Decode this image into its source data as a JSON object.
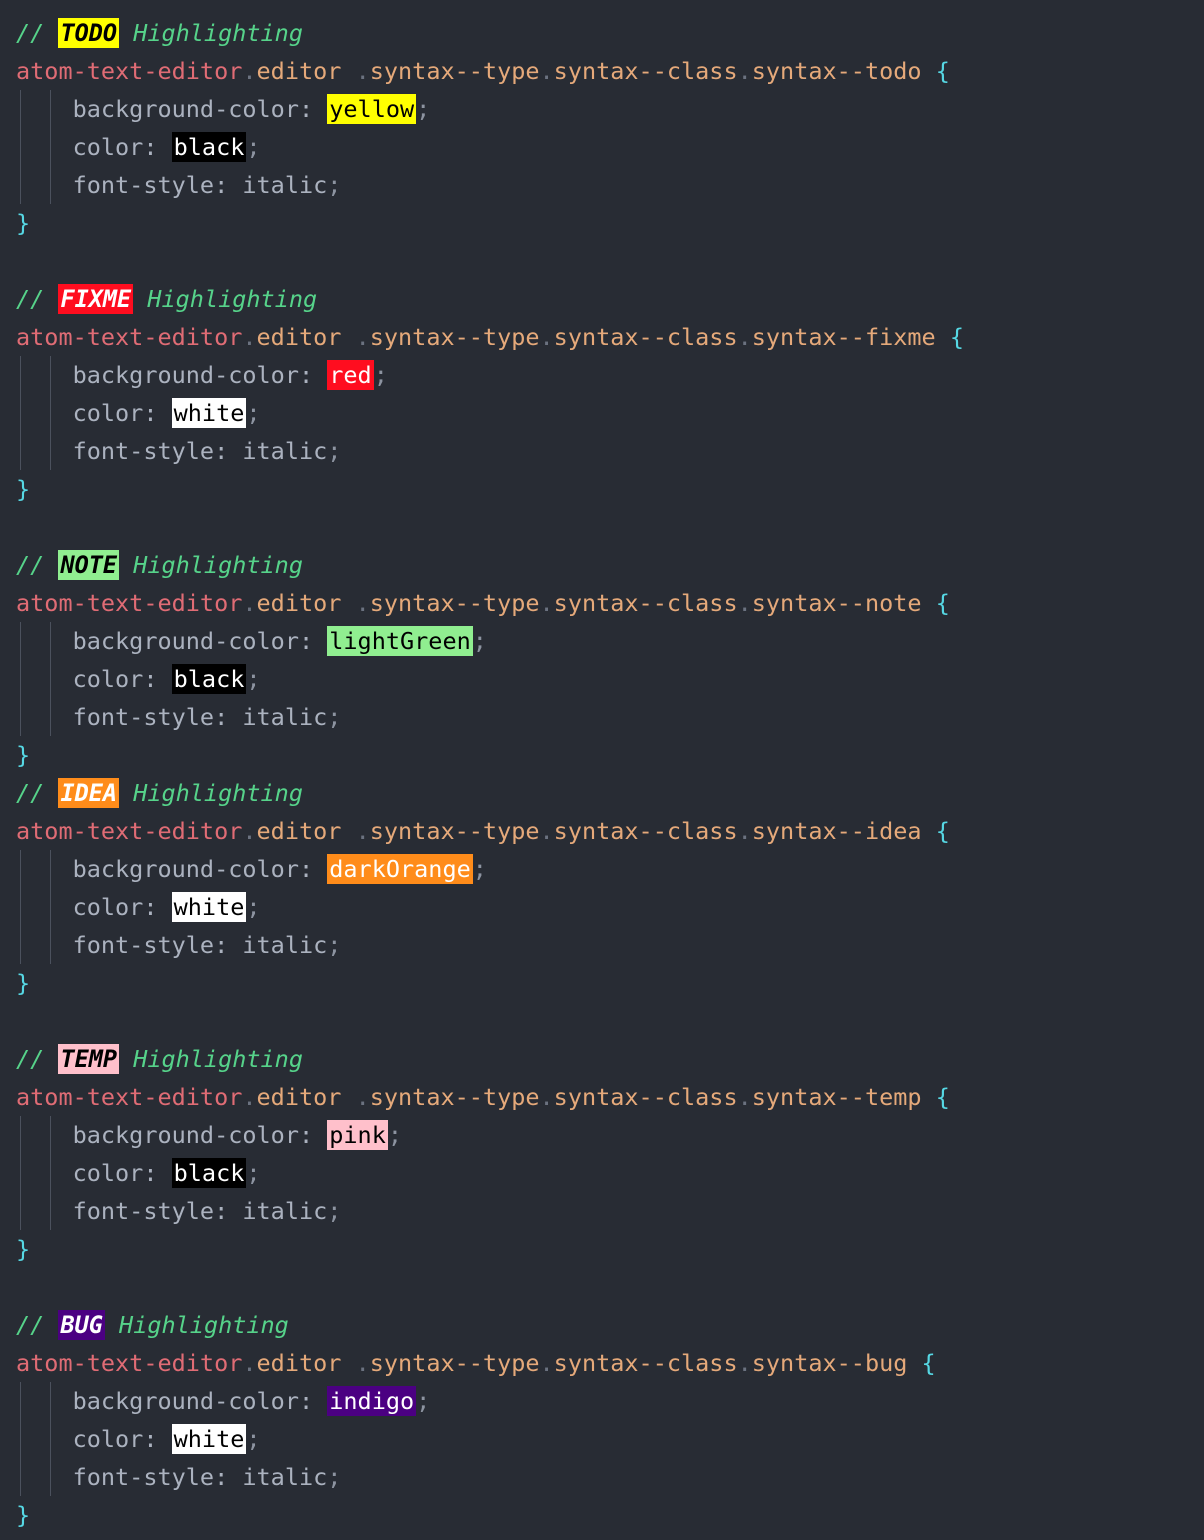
{
  "editor": {
    "language": "CSS",
    "theme": {
      "background": "#282c34",
      "comment_color": "#56d38a",
      "tag_color": "#e06c75",
      "class_color": "#e5a97a",
      "brace_color": "#56d8e4",
      "property_color": "#abb2bf",
      "punctuation_color": "#8d94a1",
      "indent_guide_color": "#4b515d"
    },
    "indent": "    ",
    "selector_prefix": {
      "tag": "atom-text-editor",
      "dot1": ".",
      "editor": "editor",
      "space": " ",
      "dot2": ".",
      "type": "syntax--type",
      "dot3": ".",
      "class": "syntax--class",
      "dot4": "."
    },
    "properties": {
      "background_color": "background-color:",
      "color": "color:",
      "font_style": "font-style:",
      "italic_value": "italic",
      "semicolon": ";",
      "open_brace": "{",
      "close_brace": "}",
      "comment_slashes": "//",
      "comment_suffix": "Highlighting"
    },
    "blocks": [
      {
        "id": "todo",
        "badge_label": "TODO",
        "badge_bg": "#ffff00",
        "badge_fg": "#000000",
        "selector_leaf": "syntax--todo",
        "bg_value": "yellow",
        "bg_swatch_bg": "#ffff00",
        "bg_swatch_fg": "#000000",
        "color_value": "black",
        "color_swatch_bg": "#000000",
        "color_swatch_fg": "#ffffff",
        "blank_after": true
      },
      {
        "id": "fixme",
        "badge_label": "FIXME",
        "badge_bg": "#ff0d1f",
        "badge_fg": "#ffffff",
        "selector_leaf": "syntax--fixme",
        "bg_value": "red",
        "bg_swatch_bg": "#ff0d1f",
        "bg_swatch_fg": "#ffffff",
        "color_value": "white",
        "color_swatch_bg": "#ffffff",
        "color_swatch_fg": "#000000",
        "blank_after": true
      },
      {
        "id": "note",
        "badge_label": "NOTE",
        "badge_bg": "#90ee90",
        "badge_fg": "#000000",
        "selector_leaf": "syntax--note",
        "bg_value": "lightGreen",
        "bg_swatch_bg": "#90ee90",
        "bg_swatch_fg": "#000000",
        "color_value": "black",
        "color_swatch_bg": "#000000",
        "color_swatch_fg": "#ffffff",
        "blank_after": false
      },
      {
        "id": "idea",
        "badge_label": "IDEA",
        "badge_bg": "#ff8c1a",
        "badge_fg": "#ffffff",
        "selector_leaf": "syntax--idea",
        "bg_value": "darkOrange",
        "bg_swatch_bg": "#ff8c1a",
        "bg_swatch_fg": "#ffffff",
        "color_value": "white",
        "color_swatch_bg": "#ffffff",
        "color_swatch_fg": "#000000",
        "blank_after": true
      },
      {
        "id": "temp",
        "badge_label": "TEMP",
        "badge_bg": "#ffc0cb",
        "badge_fg": "#000000",
        "selector_leaf": "syntax--temp",
        "bg_value": "pink",
        "bg_swatch_bg": "#ffc0cb",
        "bg_swatch_fg": "#000000",
        "color_value": "black",
        "color_swatch_bg": "#000000",
        "color_swatch_fg": "#ffffff",
        "blank_after": true
      },
      {
        "id": "bug",
        "badge_label": "BUG",
        "badge_bg": "#4b0082",
        "badge_fg": "#ffffff",
        "selector_leaf": "syntax--bug",
        "bg_value": "indigo",
        "bg_swatch_bg": "#4b0082",
        "bg_swatch_fg": "#ffffff",
        "color_value": "white",
        "color_swatch_bg": "#ffffff",
        "color_swatch_fg": "#000000",
        "blank_after": false
      }
    ]
  }
}
